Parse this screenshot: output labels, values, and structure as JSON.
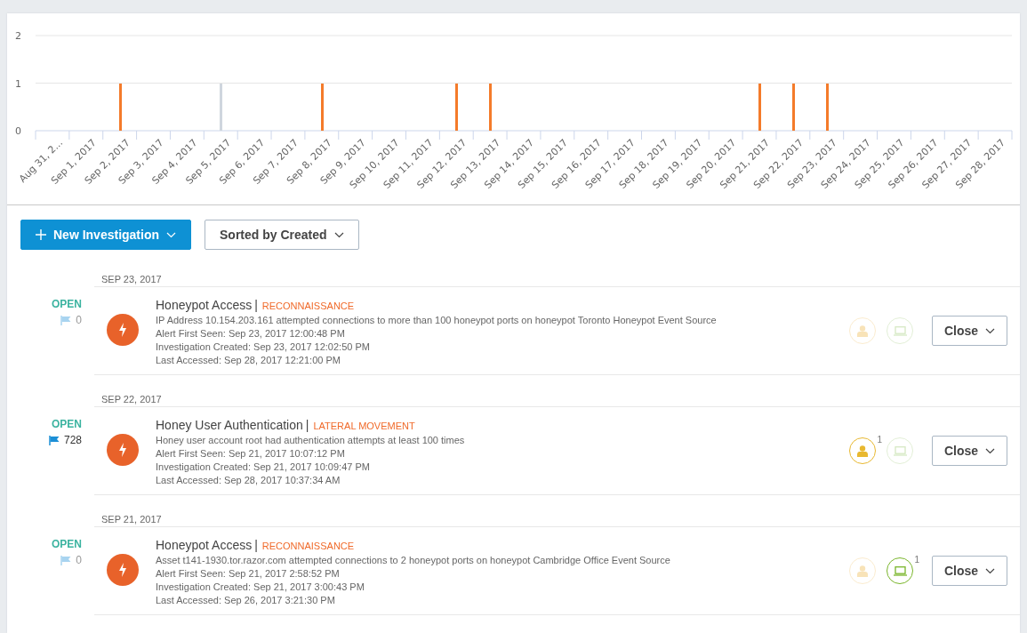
{
  "chart_data": {
    "type": "bar",
    "categories": [
      "Aug 31, 2...",
      "Sep 1, 2017",
      "Sep 2, 2017",
      "Sep 3, 2017",
      "Sep 4, 2017",
      "Sep 5, 2017",
      "Sep 6, 2017",
      "Sep 7, 2017",
      "Sep 8, 2017",
      "Sep 9, 2017",
      "Sep 10, 2017",
      "Sep 11, 2017",
      "Sep 12, 2017",
      "Sep 13, 2017",
      "Sep 14, 2017",
      "Sep 15, 2017",
      "Sep 16, 2017",
      "Sep 17, 2017",
      "Sep 18, 2017",
      "Sep 19, 2017",
      "Sep 20, 2017",
      "Sep 21, 2017",
      "Sep 22, 2017",
      "Sep 23, 2017",
      "Sep 24, 2017",
      "Sep 25, 2017",
      "Sep 26, 2017",
      "Sep 27, 2017",
      "Sep 28, 2017"
    ],
    "series": [
      {
        "color": "#f47b2a",
        "values": [
          null,
          null,
          1,
          null,
          null,
          null,
          null,
          null,
          1,
          null,
          null,
          null,
          1,
          1,
          null,
          null,
          null,
          null,
          null,
          null,
          null,
          1,
          1,
          1,
          null,
          null,
          null,
          null,
          null
        ]
      },
      {
        "color": "#cfd6de",
        "values": [
          null,
          null,
          null,
          null,
          null,
          1,
          null,
          null,
          null,
          null,
          null,
          null,
          null,
          null,
          null,
          null,
          null,
          null,
          null,
          null,
          null,
          null,
          null,
          null,
          null,
          null,
          null,
          null,
          null
        ]
      }
    ],
    "ylim": [
      0,
      2
    ],
    "yticks": [
      0,
      1,
      2
    ]
  },
  "toolbar": {
    "new_button": "New Investigation",
    "sort_button": "Sorted by Created"
  },
  "groups": [
    {
      "date": "SEP 23, 2017",
      "investigations": [
        {
          "status": "OPEN",
          "flag_active": false,
          "flag_count": "0",
          "title": "Honeypot Access",
          "separator": "|",
          "tag": "RECONNAISSANCE",
          "description": "IP Address 10.154.203.161 attempted connections to more than 100 honeypot ports on honeypot Toronto Honeypot Event Source",
          "first_seen": "Alert First Seen: Sep 23, 2017 12:00:48 PM",
          "created": "Investigation Created: Sep 23, 2017 12:02:50 PM",
          "accessed": "Last Accessed: Sep 28, 2017 12:21:00 PM",
          "user_badge": {
            "active": false
          },
          "device_badge": {
            "active": false
          },
          "close_button": "Close"
        }
      ]
    },
    {
      "date": "SEP 22, 2017",
      "investigations": [
        {
          "status": "OPEN",
          "flag_active": true,
          "flag_count": "728",
          "title": "Honey User Authentication",
          "separator": "|",
          "tag": "LATERAL MOVEMENT",
          "description": "Honey user account root had authentication attempts at least 100 times",
          "first_seen": "Alert First Seen: Sep 21, 2017 10:07:12 PM",
          "created": "Investigation Created: Sep 21, 2017 10:09:47 PM",
          "accessed": "Last Accessed: Sep 28, 2017 10:37:34 AM",
          "user_badge": {
            "active": true,
            "count": "1"
          },
          "device_badge": {
            "active": false
          },
          "close_button": "Close"
        }
      ]
    },
    {
      "date": "SEP 21, 2017",
      "investigations": [
        {
          "status": "OPEN",
          "flag_active": false,
          "flag_count": "0",
          "title": "Honeypot Access",
          "separator": "|",
          "tag": "RECONNAISSANCE",
          "description": "Asset t141-1930.tor.razor.com attempted connections to 2 honeypot ports on honeypot Cambridge Office Event Source",
          "first_seen": "Alert First Seen: Sep 21, 2017 2:58:52 PM",
          "created": "Investigation Created: Sep 21, 2017 3:00:43 PM",
          "accessed": "Last Accessed: Sep 26, 2017 3:21:30 PM",
          "user_badge": {
            "active": false
          },
          "device_badge": {
            "active": true,
            "count": "1"
          },
          "close_button": "Close"
        }
      ]
    }
  ]
}
